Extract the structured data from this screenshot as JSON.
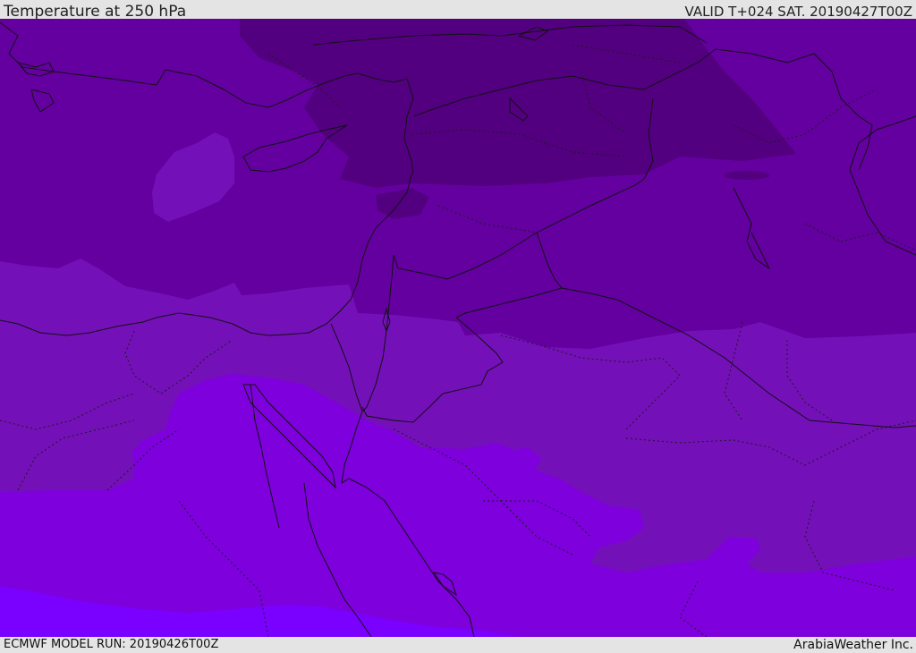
{
  "header": {
    "title": "Temperature at 250 hPa",
    "valid": "VALID T+024 SAT. 20190427T00Z"
  },
  "footer": {
    "model_run": "ECMWF MODEL RUN: 20190426T00Z",
    "credit": "ArabiaWeather Inc."
  },
  "colors": {
    "band_coldest": "#530080",
    "band_cold": "#6400a0",
    "band_mild": "#7410b8",
    "band_warm": "#7e00dc",
    "band_warmest": "#7a00ff",
    "coastline": "#111111",
    "border": "#1a1a1a"
  }
}
